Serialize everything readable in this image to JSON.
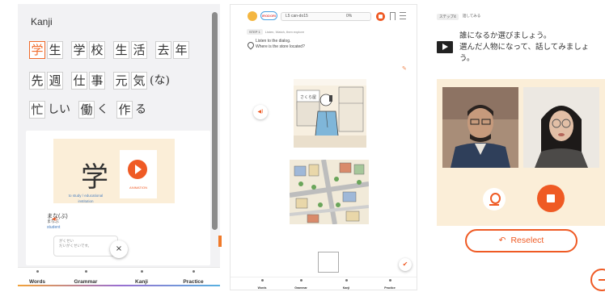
{
  "kanji_panel": {
    "title": "Kanji",
    "rows": [
      [
        {
          "chars": [
            "学",
            "生"
          ],
          "highlight": 0
        },
        {
          "chars": [
            "学",
            "校"
          ]
        },
        {
          "chars": [
            "生",
            "活"
          ]
        },
        {
          "chars": [
            "去",
            "年"
          ]
        }
      ],
      [
        {
          "chars": [
            "先",
            "週"
          ]
        },
        {
          "chars": [
            "仕",
            "事"
          ]
        },
        {
          "chars": [
            "元",
            "気"
          ],
          "suffix": "(な)"
        }
      ],
      [
        {
          "chars": [
            "忙"
          ],
          "suffix": "しい"
        },
        {
          "chars": [
            "働"
          ],
          "suffix": "く"
        },
        {
          "chars": [
            "作"
          ],
          "suffix": "る"
        }
      ]
    ],
    "detail": {
      "kanji": "学",
      "animation_label": "ANIMATION",
      "meaning_line1": "to study / educational",
      "meaning_line2": "institution",
      "example_reading": "まな(ぶ)",
      "example_sub": "まなぶ",
      "example_en": "student",
      "bubble_line1": "がくせい",
      "bubble_line2": "だいがくせいです。",
      "close_label": "×"
    },
    "tabs": [
      "Words",
      "Grammar",
      "Kanji",
      "Practice"
    ]
  },
  "listening_panel": {
    "logo": "IRODORI",
    "lesson_label": "L5 can-do15",
    "progress_text": "0%",
    "progress": 0,
    "step_badge": "STEP 1",
    "step_title": "Listen, Watch, then explore",
    "instruction_line1": "Listen to the dialog.",
    "instruction_line2": "Where is the store located?",
    "audio_icon": "speaker-icon",
    "shop_sign": "さくら屋",
    "tabs": [
      "Words",
      "Grammar",
      "Kanji",
      "Practice"
    ]
  },
  "video_panel": {
    "step_badge": "ステップ4",
    "step_title": "話してみる",
    "instruction_line1": "誰になるか選びましょう。",
    "instruction_line2": "選んだ人物になって、話してみましょ",
    "instruction_line3": "う。",
    "reselect_label": "Reselect",
    "accent_color": "#ef5a24",
    "stage_color": "#fbeed8"
  }
}
